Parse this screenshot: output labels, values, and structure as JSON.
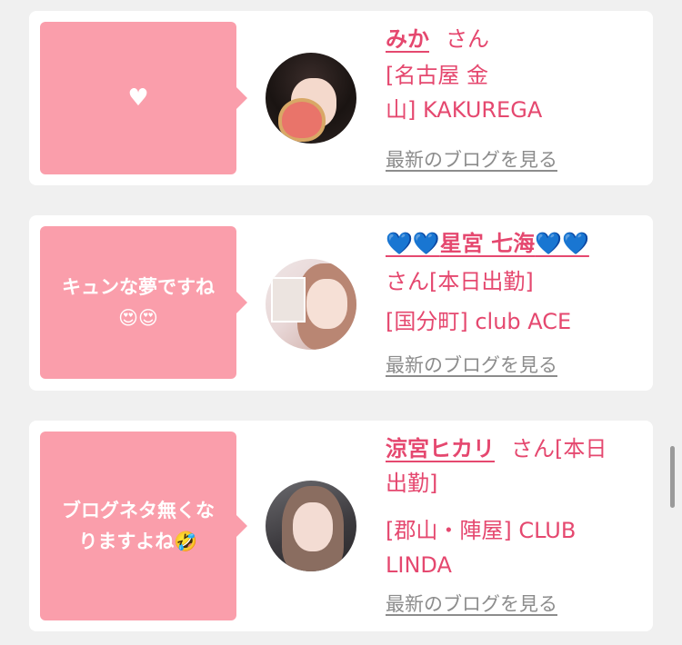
{
  "cards": [
    {
      "comment": "♥",
      "name": "みか",
      "san": "さん",
      "shop_line1": "[名古屋 金",
      "shop_line2": "山] KAKUREGA",
      "link": "最新のブログを見る"
    },
    {
      "comment_line1": "キュンな夢ですね",
      "comment_line2": "😍😍",
      "name_heart_left": "💙💙",
      "name": "星宮 七海",
      "name_heart_right": "💙💙",
      "san_line": "さん[本日出勤]",
      "shop_line": "[国分町] club ACE",
      "link": "最新のブログを見る"
    },
    {
      "comment_line1": "ブログネタ無くな",
      "comment_line2": "りますよね🤣",
      "name": "涼宮ヒカリ",
      "san": "さん[本日",
      "san_line2": "出勤]",
      "shop_line1": "[郡山・陣屋] CLUB",
      "shop_line2": "LINDA",
      "link": "最新のブログを見る"
    }
  ]
}
